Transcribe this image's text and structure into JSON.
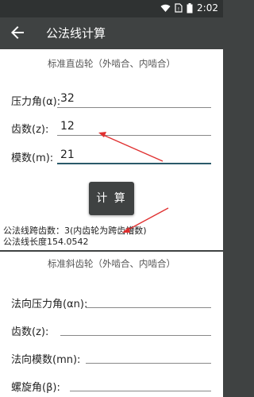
{
  "status_bar": {
    "time": "2:02"
  },
  "app_bar": {
    "title": "公法线计算"
  },
  "spur_section": {
    "title": "标准直齿轮（外啮合、内啮合）",
    "fields": [
      {
        "label": "压力角(α):",
        "value": "32"
      },
      {
        "label": "齿数(z):",
        "value": "12"
      },
      {
        "label": "模数(m):",
        "value": "21"
      }
    ],
    "calc_button": "计 算",
    "results": [
      "公法线跨齿数：3(内齿轮为跨齿槽数)",
      "公法线长度154.0542"
    ]
  },
  "helical_section": {
    "title": "标准斜齿轮（外啮合、内啮合）",
    "fields": [
      {
        "label": "法向压力角(αn):",
        "value": ""
      },
      {
        "label": "齿数(z):",
        "value": ""
      },
      {
        "label": "法向模数(mn):",
        "value": ""
      },
      {
        "label": "螺旋角(β):",
        "value": ""
      }
    ]
  },
  "colors": {
    "toolbar": "#3f4242",
    "accent": "#2a5a6a",
    "annotation_arrow": "#e03030"
  }
}
